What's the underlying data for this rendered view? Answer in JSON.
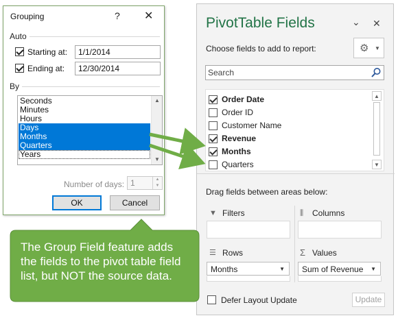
{
  "grouping_dialog": {
    "title": "Grouping",
    "help_glyph": "?",
    "close_glyph": "✕",
    "auto_label": "Auto",
    "starting_at": {
      "label": "Starting at:",
      "checked": true,
      "value": "1/1/2014"
    },
    "ending_at": {
      "label": "Ending at:",
      "checked": true,
      "value": "12/30/2014"
    },
    "by_label": "By",
    "by_items": [
      {
        "label": "Seconds",
        "selected": false
      },
      {
        "label": "Minutes",
        "selected": false
      },
      {
        "label": "Hours",
        "selected": false
      },
      {
        "label": "Days",
        "selected": true
      },
      {
        "label": "Months",
        "selected": true
      },
      {
        "label": "Quarters",
        "selected": true
      },
      {
        "label": "Years",
        "selected": false
      }
    ],
    "number_of_days_label": "Number of days:",
    "number_of_days_value": "1",
    "ok_label": "OK",
    "cancel_label": "Cancel"
  },
  "pivot_pane": {
    "title": "PivotTable Fields",
    "dropdown_glyph": "⌄",
    "close_glyph": "✕",
    "subtitle": "Choose fields to add to report:",
    "settings_icon": "gear-icon",
    "search_placeholder": "Search",
    "fields": [
      {
        "label": "Order Date",
        "checked": true,
        "bold": true
      },
      {
        "label": "Order ID",
        "checked": false,
        "bold": false
      },
      {
        "label": "Customer Name",
        "checked": false,
        "bold": false
      },
      {
        "label": "Revenue",
        "checked": true,
        "bold": true
      },
      {
        "label": "Months",
        "checked": true,
        "bold": true
      },
      {
        "label": "Quarters",
        "checked": false,
        "bold": false
      }
    ],
    "drag_text": "Drag fields between areas below:",
    "areas": {
      "filters": {
        "label": "Filters",
        "icon": "filter-icon"
      },
      "columns": {
        "label": "Columns",
        "icon": "columns-icon"
      },
      "rows": {
        "label": "Rows",
        "icon": "rows-icon",
        "chip": "Months"
      },
      "values": {
        "label": "Values",
        "icon": "sigma-icon",
        "chip": "Sum of Revenue"
      }
    },
    "defer_label": "Defer Layout Update",
    "update_label": "Update"
  },
  "callout": {
    "lines": [
      "The Group Field feature adds",
      "the fields to the pivot table field",
      "list, but NOT the source data."
    ],
    "fill_color": "#70ad47",
    "arrow_color": "#70ad47"
  },
  "colors": {
    "pivot_title": "#217346",
    "selection": "#0078d7"
  }
}
